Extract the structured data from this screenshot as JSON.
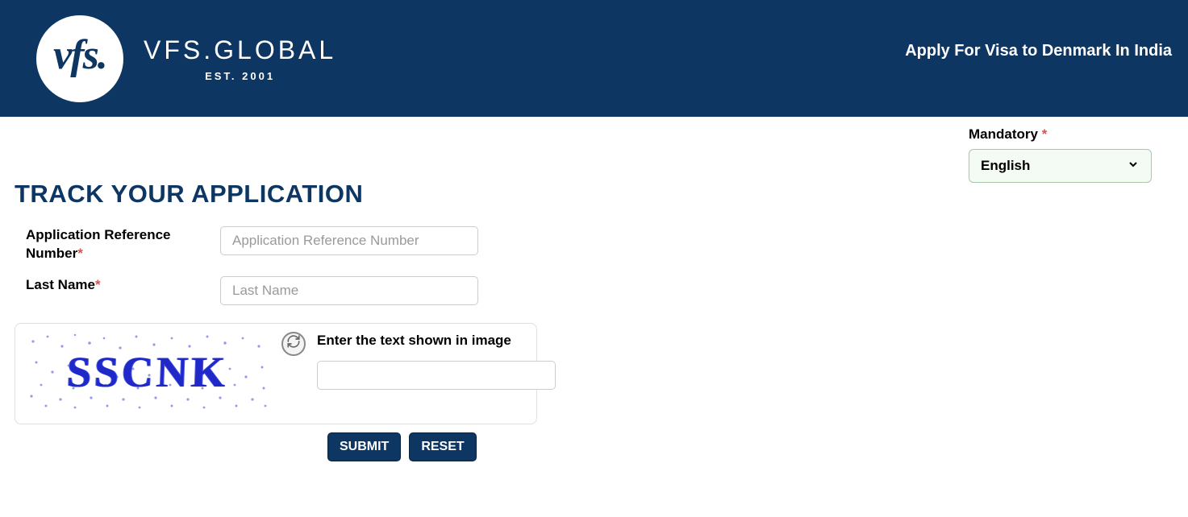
{
  "header": {
    "logo_abbrev": "vfs.",
    "brand": "VFS.GLOBAL",
    "est": "EST. 2001",
    "right_text": "Apply For Visa to Denmark  In India"
  },
  "mandatory": {
    "label": "Mandatory",
    "star": "*"
  },
  "language": {
    "selected": "English"
  },
  "page": {
    "title": "TRACK YOUR APPLICATION"
  },
  "form": {
    "ref_label": "Application Reference Number",
    "ref_star": "*",
    "ref_placeholder": "Application Reference Number",
    "lastname_label": "Last Name",
    "lastname_star": "*",
    "lastname_placeholder": "Last Name"
  },
  "captcha": {
    "image_text": "SSCNK",
    "label": "Enter the text shown in image"
  },
  "buttons": {
    "submit": "SUBMIT",
    "reset": "RESET"
  }
}
